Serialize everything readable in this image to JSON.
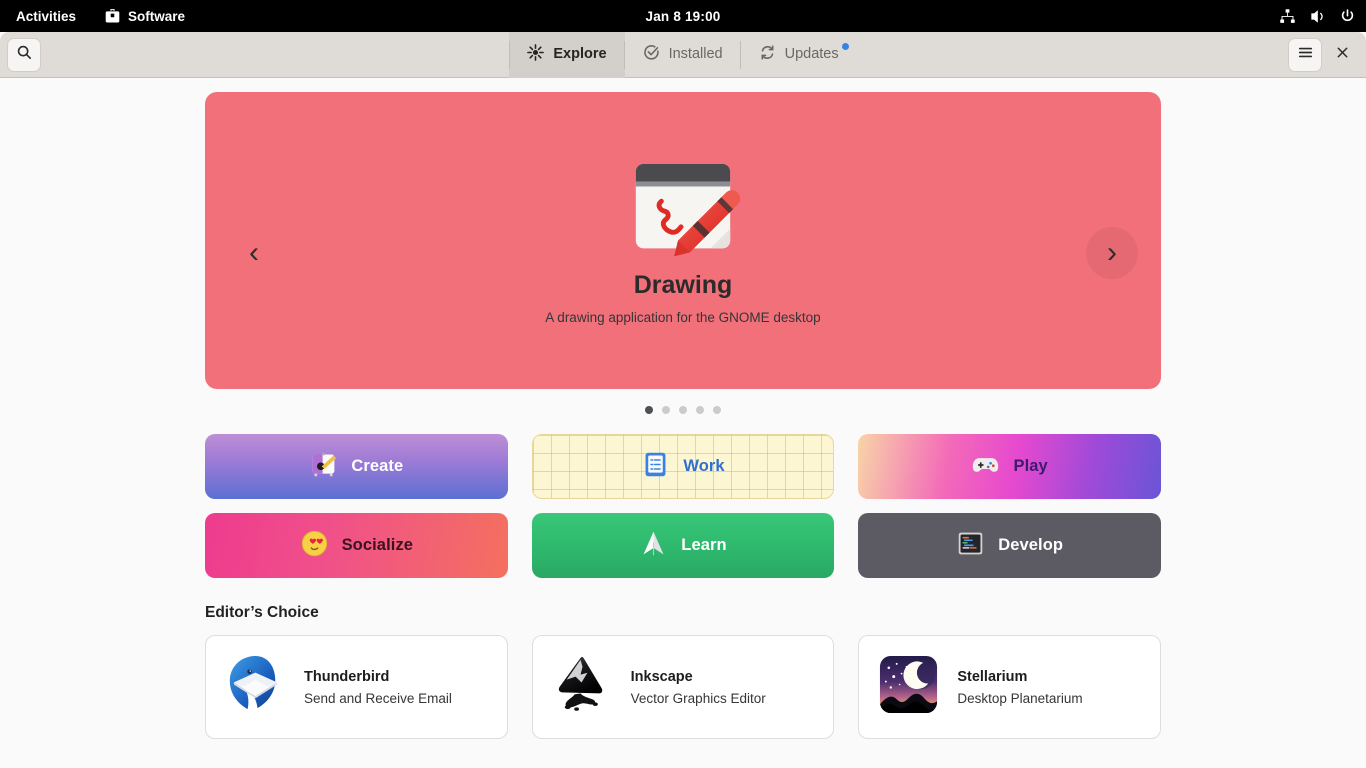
{
  "topbar": {
    "activities": "Activities",
    "app_name": "Software",
    "app_icon": "software-icon",
    "clock": "Jan 8  19:00",
    "icons": [
      "network-wired-icon",
      "volume-icon",
      "power-icon"
    ]
  },
  "headerbar": {
    "search_icon": "search-icon",
    "menu_icon": "hamburger-menu-icon",
    "close_icon": "close-icon",
    "tabs": [
      {
        "label": "Explore",
        "icon": "explore-star-icon",
        "active": true,
        "badge": false
      },
      {
        "label": "Installed",
        "icon": "check-circle-icon",
        "active": false,
        "badge": false
      },
      {
        "label": "Updates",
        "icon": "refresh-icon",
        "active": false,
        "badge": true
      }
    ]
  },
  "hero": {
    "app_name": "Drawing",
    "summary": "A drawing application for the GNOME desktop",
    "background_color": "#f2707a",
    "icon": "drawing-app-icon",
    "prev_label": "‹",
    "next_label": "›",
    "dots_count": 5,
    "active_dot": 0
  },
  "categories": [
    {
      "label": "Create",
      "icon": "art-palette-icon",
      "class": "tile-create"
    },
    {
      "label": "Work",
      "icon": "clipboard-icon",
      "class": "tile-work"
    },
    {
      "label": "Play",
      "icon": "gamepad-icon",
      "class": "tile-play"
    },
    {
      "label": "Socialize",
      "icon": "heart-eyes-emoji-icon",
      "class": "tile-socialize"
    },
    {
      "label": "Learn",
      "icon": "paper-plane-icon",
      "class": "tile-learn"
    },
    {
      "label": "Develop",
      "icon": "code-terminal-icon",
      "class": "tile-develop"
    }
  ],
  "editors_choice": {
    "heading": "Editor’s Choice",
    "apps": [
      {
        "name": "Thunderbird",
        "summary": "Send and Receive Email",
        "icon": "thunderbird-icon"
      },
      {
        "name": "Inkscape",
        "summary": "Vector Graphics Editor",
        "icon": "inkscape-icon"
      },
      {
        "name": "Stellarium",
        "summary": "Desktop Planetarium",
        "icon": "stellarium-icon"
      }
    ]
  },
  "colors": {
    "accent": "#3584e4",
    "hero": "#f2707a",
    "headerbar": "#dfdcd8",
    "window_bg": "#fafafa"
  }
}
